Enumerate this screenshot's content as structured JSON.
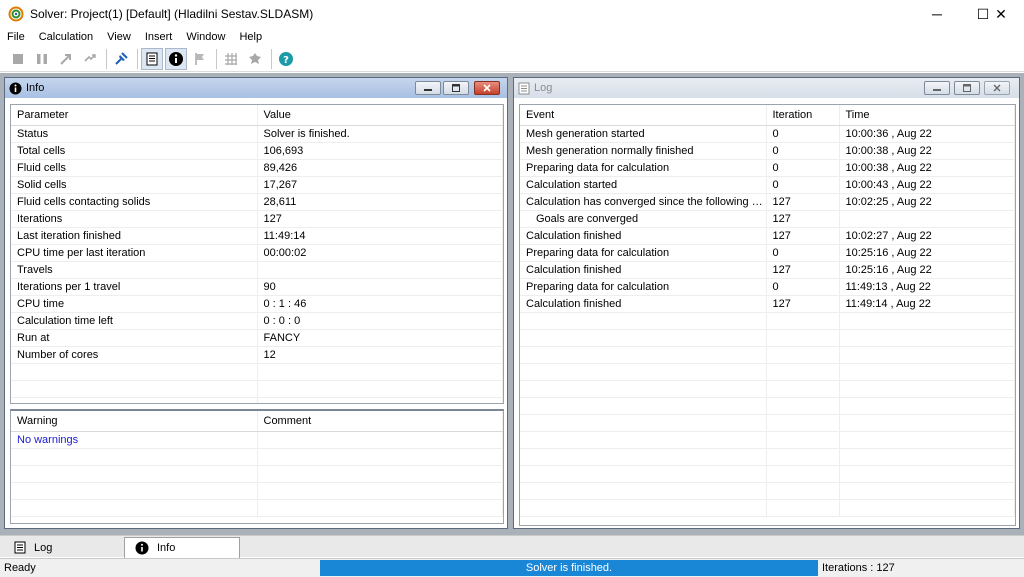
{
  "window": {
    "title": "Solver: Project(1) [Default] (Hladilni Sestav.SLDASM)",
    "minimize_glyph": "─",
    "maximize_glyph": "☐",
    "close_glyph": "✕"
  },
  "menu": [
    "File",
    "Calculation",
    "View",
    "Insert",
    "Window",
    "Help"
  ],
  "toolbar": {
    "icons": [
      "stop-icon",
      "pause-icon",
      "resume-icon",
      "refresh-icon",
      "pin-icon",
      "log-icon",
      "info-icon",
      "flag-icon",
      "table-icon",
      "gear-icon",
      "help-icon"
    ]
  },
  "info_panel": {
    "title": "Info",
    "columns": [
      "Parameter",
      "Value"
    ],
    "rows": [
      [
        "Status",
        "Solver is finished."
      ],
      [
        "Total cells",
        "106,693"
      ],
      [
        "Fluid cells",
        "89,426"
      ],
      [
        "Solid cells",
        "17,267"
      ],
      [
        "Fluid cells contacting solids",
        "28,611"
      ],
      [
        "Iterations",
        "127"
      ],
      [
        "Last iteration finished",
        "11:49:14"
      ],
      [
        "CPU time per last iteration",
        "00:00:02"
      ],
      [
        "Travels",
        ""
      ],
      [
        "Iterations per 1 travel",
        "90"
      ],
      [
        "CPU time",
        "0 : 1 : 46"
      ],
      [
        "Calculation time left",
        "0 : 0 : 0"
      ],
      [
        "Run at",
        "FANCY"
      ],
      [
        "Number of cores",
        "12"
      ]
    ],
    "warning_columns": [
      "Warning",
      "Comment"
    ],
    "warning_rows": [
      [
        "No warnings",
        ""
      ]
    ]
  },
  "log_panel": {
    "title": "Log",
    "columns": [
      "Event",
      "Iteration",
      "Time"
    ],
    "rows": [
      [
        "Mesh generation started",
        "0",
        "10:00:36 , Aug 22"
      ],
      [
        "Mesh generation normally finished",
        "0",
        "10:00:38 , Aug 22"
      ],
      [
        "Preparing data for calculation",
        "0",
        "10:00:38 , Aug 22"
      ],
      [
        "Calculation started",
        "0",
        "10:00:43 , Aug 22"
      ],
      [
        "Calculation has converged since the following criteria are satisfied",
        "127",
        "10:02:25 , Aug 22"
      ],
      [
        "    Goals are converged",
        "127",
        ""
      ],
      [
        "Calculation finished",
        "127",
        "10:02:27 , Aug 22"
      ],
      [
        "Preparing data for calculation",
        "0",
        "10:25:16 , Aug 22"
      ],
      [
        "Calculation finished",
        "127",
        "10:25:16 , Aug 22"
      ],
      [
        "Preparing data for calculation",
        "0",
        "11:49:13 , Aug 22"
      ],
      [
        "Calculation finished",
        "127",
        "11:49:14 , Aug 22"
      ]
    ]
  },
  "tabs": [
    "Log",
    "Info"
  ],
  "status": {
    "left": "Ready",
    "center": "Solver is finished.",
    "right": "Iterations : 127"
  },
  "colors": {
    "progress": "#1a86d6",
    "workspace": "#abb1b9",
    "link": "#1a1ad6"
  }
}
